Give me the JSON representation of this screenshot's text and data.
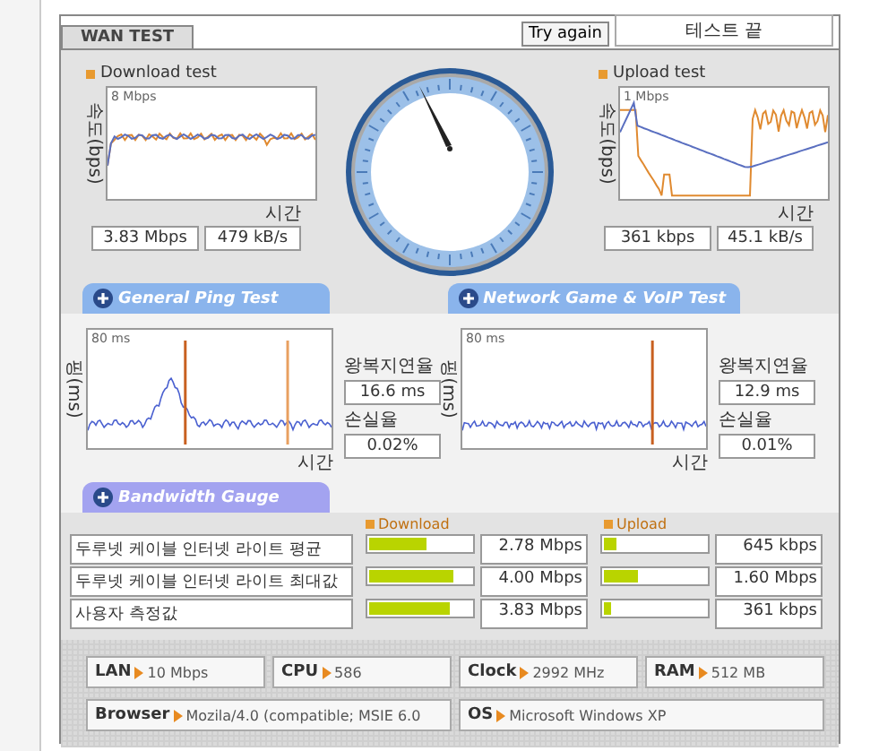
{
  "header": {
    "tab": "WAN TEST",
    "retry_button": "Try again",
    "status": "테스트 끝"
  },
  "speed_tests": [
    {
      "title": "Download test",
      "y_label": "속도(bps)",
      "scale": "8 Mbps",
      "x_label": "시간",
      "readings": [
        "3.83 Mbps",
        "479 kB/s"
      ],
      "tab": "General Ping Test"
    },
    {
      "title": "Upload test",
      "y_label": "속도(bps)",
      "scale": "1 Mbps",
      "x_label": "시간",
      "readings": [
        "361 kbps",
        "45.1 kB/s"
      ],
      "tab": "Network Game & VoIP Test"
    }
  ],
  "ping_tests": [
    {
      "y_label": "핑(ms)",
      "scale": "80 ms",
      "x_label": "시간",
      "latency_label": "왕복지연율",
      "latency": "16.6 ms",
      "loss_label": "손실율",
      "loss": "0.02%"
    },
    {
      "y_label": "핑(ms)",
      "scale": "80 ms",
      "x_label": "시간",
      "latency_label": "왕복지연율",
      "latency": "12.9 ms",
      "loss_label": "손실율",
      "loss": "0.01%"
    }
  ],
  "bandwidth": {
    "tab": "Bandwidth Gauge",
    "download_header": "Download",
    "upload_header": "Upload",
    "rows": [
      {
        "label": "두루넷 케이블 인터넷 라이트 평균",
        "download": {
          "level": 0.56,
          "reading": "2.78 Mbps"
        },
        "upload": {
          "level": 0.12,
          "reading": "645 kbps"
        }
      },
      {
        "label": "두루넷 케이블 인터넷 라이트 최대값",
        "download": {
          "level": 0.83,
          "reading": "4.00 Mbps"
        },
        "upload": {
          "level": 0.33,
          "reading": "1.60 Mbps"
        }
      },
      {
        "label": "사용자 측정값",
        "download": {
          "level": 0.79,
          "reading": "3.83 Mbps"
        },
        "upload": {
          "level": 0.07,
          "reading": "361 kbps"
        }
      }
    ]
  },
  "system": [
    {
      "label": "LAN",
      "value": "10 Mbps"
    },
    {
      "label": "CPU",
      "value": "586"
    },
    {
      "label": "Clock",
      "value": "2992 MHz"
    },
    {
      "label": "RAM",
      "value": "512 MB"
    },
    {
      "label": "Browser",
      "value": "Mozila/4.0 (compatible; MSIE 6.0"
    },
    {
      "label": "OS",
      "value": "Microsoft Windows XP"
    }
  ]
}
